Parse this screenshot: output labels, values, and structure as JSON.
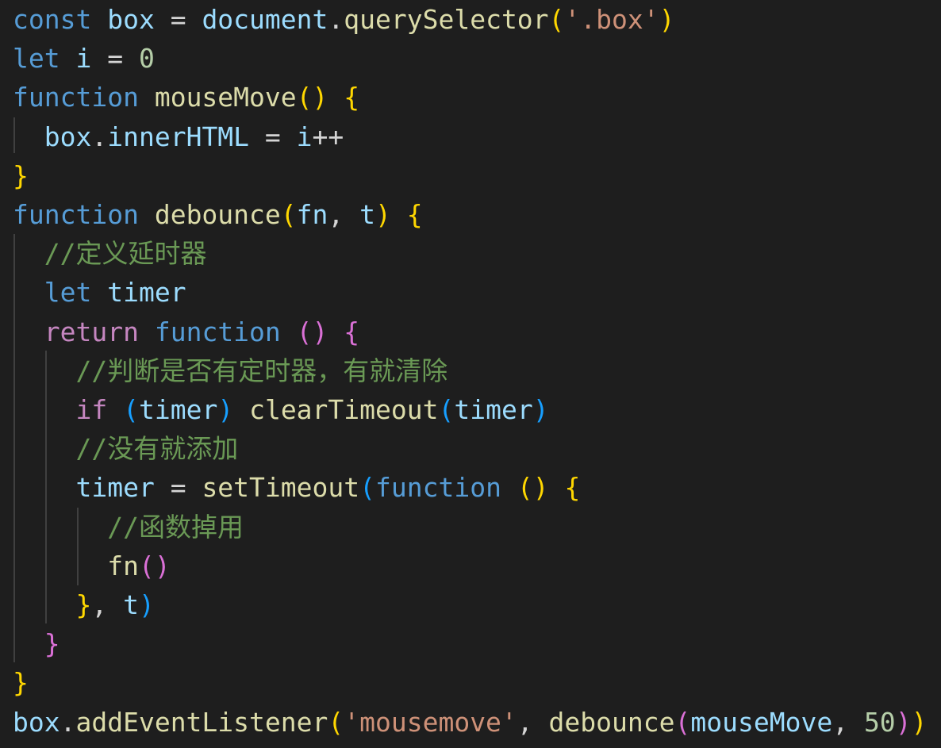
{
  "theme": {
    "background": "#1e1e1e",
    "colors": {
      "keyword": "#569cd6",
      "control": "#c586c0",
      "variable": "#9cdcfe",
      "function": "#dcdcaa",
      "string": "#ce9178",
      "number": "#b5cea8",
      "comment": "#6a9955",
      "operator": "#d4d4d4",
      "bracket1": "#ffd700",
      "bracket2": "#da70d6",
      "bracket3": "#179fff",
      "guide": "#404040"
    }
  },
  "code": {
    "lines": [
      [
        {
          "t": "const",
          "c": "keyword"
        },
        {
          "t": " ",
          "c": "operator"
        },
        {
          "t": "box",
          "c": "variable"
        },
        {
          "t": " = ",
          "c": "operator"
        },
        {
          "t": "document",
          "c": "variable"
        },
        {
          "t": ".",
          "c": "operator"
        },
        {
          "t": "querySelector",
          "c": "function"
        },
        {
          "t": "(",
          "c": "bracket1"
        },
        {
          "t": "'.box'",
          "c": "string"
        },
        {
          "t": ")",
          "c": "bracket1"
        }
      ],
      [
        {
          "t": "let",
          "c": "keyword"
        },
        {
          "t": " ",
          "c": "operator"
        },
        {
          "t": "i",
          "c": "variable"
        },
        {
          "t": " = ",
          "c": "operator"
        },
        {
          "t": "0",
          "c": "number"
        }
      ],
      [
        {
          "t": "function",
          "c": "keyword"
        },
        {
          "t": " ",
          "c": "operator"
        },
        {
          "t": "mouseMove",
          "c": "function"
        },
        {
          "t": "()",
          "c": "bracket1"
        },
        {
          "t": " ",
          "c": "operator"
        },
        {
          "t": "{",
          "c": "bracket1"
        }
      ],
      [
        {
          "t": "  ",
          "c": "operator"
        },
        {
          "t": "box",
          "c": "variable"
        },
        {
          "t": ".",
          "c": "operator"
        },
        {
          "t": "innerHTML",
          "c": "variable"
        },
        {
          "t": " = ",
          "c": "operator"
        },
        {
          "t": "i",
          "c": "variable"
        },
        {
          "t": "++",
          "c": "operator"
        }
      ],
      [
        {
          "t": "}",
          "c": "bracket1"
        }
      ],
      [
        {
          "t": "function",
          "c": "keyword"
        },
        {
          "t": " ",
          "c": "operator"
        },
        {
          "t": "debounce",
          "c": "function"
        },
        {
          "t": "(",
          "c": "bracket1"
        },
        {
          "t": "fn",
          "c": "variable"
        },
        {
          "t": ", ",
          "c": "operator"
        },
        {
          "t": "t",
          "c": "variable"
        },
        {
          "t": ")",
          "c": "bracket1"
        },
        {
          "t": " ",
          "c": "operator"
        },
        {
          "t": "{",
          "c": "bracket1"
        }
      ],
      [
        {
          "t": "  ",
          "c": "operator"
        },
        {
          "t": "//定义延时器",
          "c": "comment"
        }
      ],
      [
        {
          "t": "  ",
          "c": "operator"
        },
        {
          "t": "let",
          "c": "keyword"
        },
        {
          "t": " ",
          "c": "operator"
        },
        {
          "t": "timer",
          "c": "variable"
        }
      ],
      [
        {
          "t": "  ",
          "c": "operator"
        },
        {
          "t": "return",
          "c": "control"
        },
        {
          "t": " ",
          "c": "operator"
        },
        {
          "t": "function",
          "c": "keyword"
        },
        {
          "t": " ",
          "c": "operator"
        },
        {
          "t": "()",
          "c": "bracket2"
        },
        {
          "t": " ",
          "c": "operator"
        },
        {
          "t": "{",
          "c": "bracket2"
        }
      ],
      [
        {
          "t": "    ",
          "c": "operator"
        },
        {
          "t": "//判断是否有定时器，有就清除",
          "c": "comment"
        }
      ],
      [
        {
          "t": "    ",
          "c": "operator"
        },
        {
          "t": "if",
          "c": "control"
        },
        {
          "t": " ",
          "c": "operator"
        },
        {
          "t": "(",
          "c": "bracket3"
        },
        {
          "t": "timer",
          "c": "variable"
        },
        {
          "t": ")",
          "c": "bracket3"
        },
        {
          "t": " ",
          "c": "operator"
        },
        {
          "t": "clearTimeout",
          "c": "function"
        },
        {
          "t": "(",
          "c": "bracket3"
        },
        {
          "t": "timer",
          "c": "variable"
        },
        {
          "t": ")",
          "c": "bracket3"
        }
      ],
      [
        {
          "t": "    ",
          "c": "operator"
        },
        {
          "t": "//没有就添加",
          "c": "comment"
        }
      ],
      [
        {
          "t": "    ",
          "c": "operator"
        },
        {
          "t": "timer",
          "c": "variable"
        },
        {
          "t": " = ",
          "c": "operator"
        },
        {
          "t": "setTimeout",
          "c": "function"
        },
        {
          "t": "(",
          "c": "bracket3"
        },
        {
          "t": "function",
          "c": "keyword"
        },
        {
          "t": " ",
          "c": "operator"
        },
        {
          "t": "()",
          "c": "bracket1"
        },
        {
          "t": " ",
          "c": "operator"
        },
        {
          "t": "{",
          "c": "bracket1"
        }
      ],
      [
        {
          "t": "      ",
          "c": "operator"
        },
        {
          "t": "//函数掉用",
          "c": "comment"
        }
      ],
      [
        {
          "t": "      ",
          "c": "operator"
        },
        {
          "t": "fn",
          "c": "function"
        },
        {
          "t": "()",
          "c": "bracket2"
        }
      ],
      [
        {
          "t": "    ",
          "c": "operator"
        },
        {
          "t": "}",
          "c": "bracket1"
        },
        {
          "t": ", ",
          "c": "operator"
        },
        {
          "t": "t",
          "c": "variable"
        },
        {
          "t": ")",
          "c": "bracket3"
        }
      ],
      [
        {
          "t": "  ",
          "c": "operator"
        },
        {
          "t": "}",
          "c": "bracket2"
        }
      ],
      [
        {
          "t": "}",
          "c": "bracket1"
        }
      ],
      [
        {
          "t": "box",
          "c": "variable"
        },
        {
          "t": ".",
          "c": "operator"
        },
        {
          "t": "addEventListener",
          "c": "function"
        },
        {
          "t": "(",
          "c": "bracket1"
        },
        {
          "t": "'mousemove'",
          "c": "string"
        },
        {
          "t": ", ",
          "c": "operator"
        },
        {
          "t": "debounce",
          "c": "function"
        },
        {
          "t": "(",
          "c": "bracket2"
        },
        {
          "t": "mouseMove",
          "c": "variable"
        },
        {
          "t": ", ",
          "c": "operator"
        },
        {
          "t": "50",
          "c": "number"
        },
        {
          "t": ")",
          "c": "bracket2"
        },
        {
          "t": ")",
          "c": "bracket1"
        }
      ]
    ]
  }
}
